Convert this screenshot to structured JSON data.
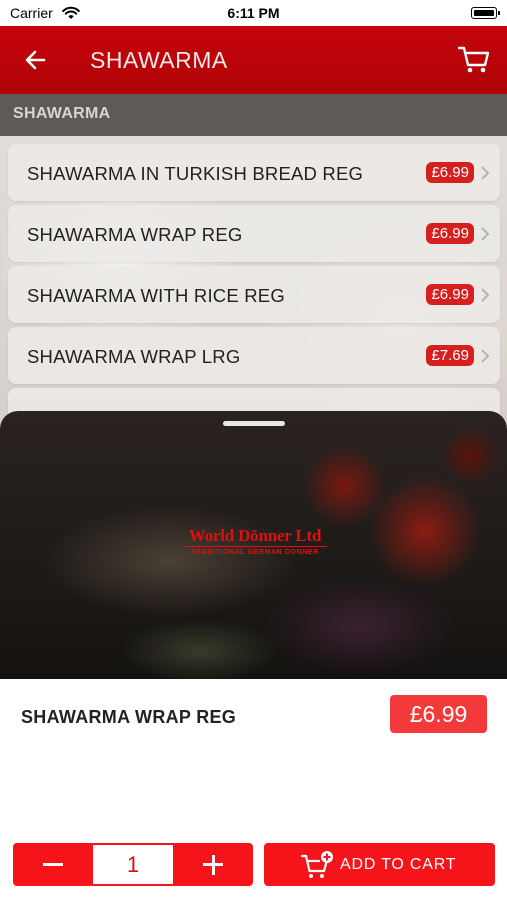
{
  "status_bar": {
    "carrier": "Carrier",
    "time": "6:11 PM"
  },
  "header": {
    "title": "SHAWARMA"
  },
  "section": {
    "title": "SHAWARMA"
  },
  "menu_items": [
    {
      "name": "SHAWARMA IN TURKISH BREAD REG",
      "price": "£6.99"
    },
    {
      "name": "SHAWARMA WRAP REG",
      "price": "£6.99"
    },
    {
      "name": "SHAWARMA WITH RICE REG",
      "price": "£6.99"
    },
    {
      "name": "SHAWARMA WRAP LRG",
      "price": "£7.69"
    }
  ],
  "brand": {
    "name": "World Dönner Ltd",
    "tagline": "TRADITIONAL GERMAN DONNER"
  },
  "selected_item": {
    "name": "SHAWARMA WRAP REG",
    "price": "£6.99"
  },
  "quantity": "1",
  "add_to_cart_label": "ADD TO CART",
  "colors": {
    "primary": "#c4050b",
    "button": "#f4141a",
    "price_badge": "#d62020"
  }
}
